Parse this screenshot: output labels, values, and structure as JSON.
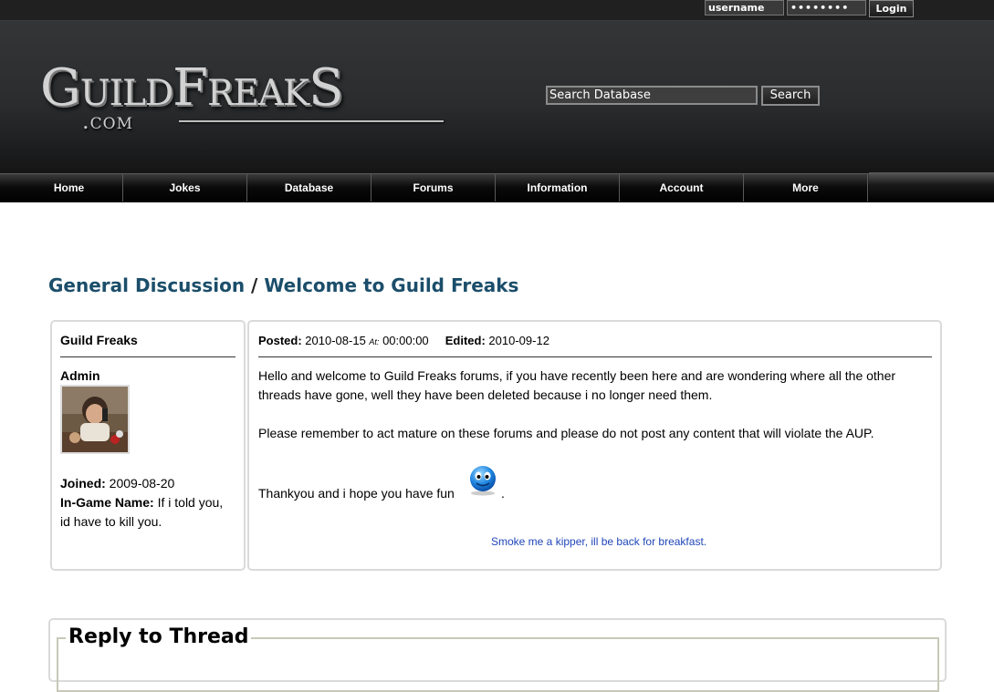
{
  "topbar": {
    "username_value": "username",
    "password_value": "••••••••",
    "login_label": "Login"
  },
  "header": {
    "logo_main": "GuildFreakS",
    "logo_sub": ".com",
    "search_value": "Search Database",
    "search_label": "Search"
  },
  "nav": {
    "items": [
      "Home",
      "Jokes",
      "Database",
      "Forums",
      "Information",
      "Account",
      "More"
    ]
  },
  "breadcrumb": {
    "section": "General Discussion",
    "separator": "/",
    "thread": "Welcome to Guild Freaks"
  },
  "author": {
    "name": "Guild Freaks",
    "rank": "Admin",
    "joined_label": "Joined:",
    "joined_value": "2009-08-20",
    "ingame_label": "In-Game Name:",
    "ingame_value_1": "If i told you,",
    "ingame_value_2": "id have to kill you."
  },
  "post": {
    "posted_label": "Posted:",
    "posted_date": "2010-08-15",
    "at_label": "At:",
    "posted_time": "00:00:00",
    "edited_label": "Edited:",
    "edited_date": "2010-09-12",
    "para1_line1": "Hello and welcome to Guild Freaks forums, if you have recently been here and are wondering where all the other",
    "para1_line2": "threads have gone, well they have been deleted because i no longer need them.",
    "para2": "Please remember to act mature on these forums and please do not post any content that will violate the AUP.",
    "para3": "Thankyou and i hope you have fun",
    "para3_end": ".",
    "signature": "Smoke me a kipper, ill be back for breakfast."
  },
  "reply": {
    "title": "Reply to Thread"
  },
  "colors": {
    "link": "#1b4e6a",
    "signature": "#2046b8",
    "header_bg": "#2a2c2e"
  }
}
